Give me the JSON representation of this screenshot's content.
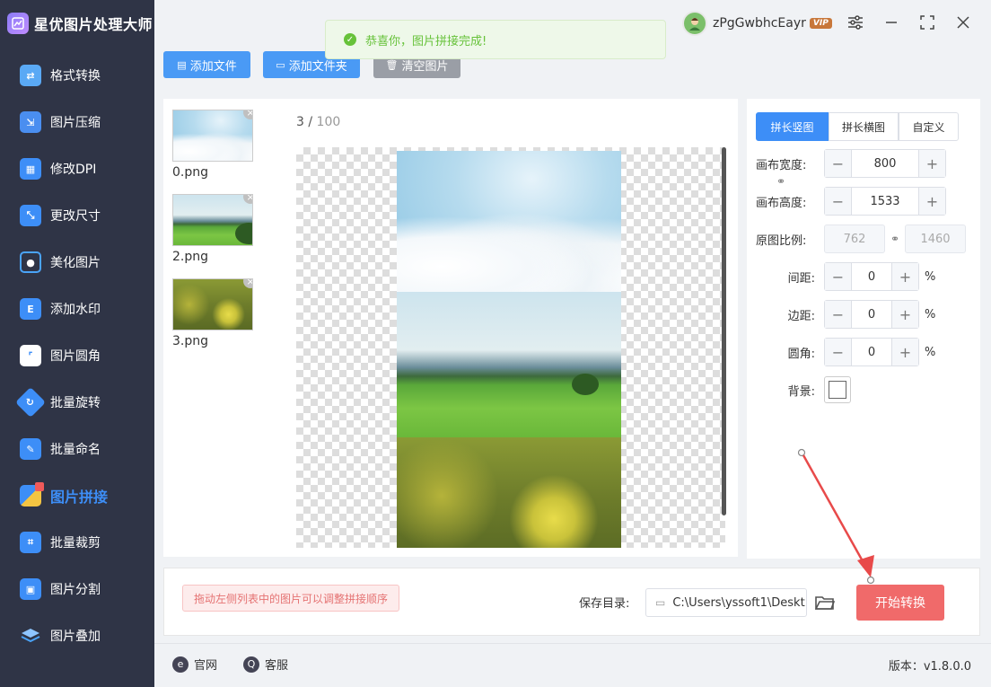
{
  "app": {
    "title": "星优图片处理大师"
  },
  "toast": {
    "text": "恭喜你，图片拼接完成!"
  },
  "user": {
    "name": "zPgGwbhcEayr",
    "badge": "VIP"
  },
  "sidebar": {
    "items": [
      {
        "label": "格式转换",
        "icon": "format-convert-icon"
      },
      {
        "label": "图片压缩",
        "icon": "compress-icon"
      },
      {
        "label": "修改DPI",
        "icon": "dpi-icon"
      },
      {
        "label": "更改尺寸",
        "icon": "resize-icon"
      },
      {
        "label": "美化图片",
        "icon": "beautify-icon"
      },
      {
        "label": "添加水印",
        "icon": "watermark-icon"
      },
      {
        "label": "图片圆角",
        "icon": "round-corner-icon"
      },
      {
        "label": "批量旋转",
        "icon": "rotate-icon"
      },
      {
        "label": "批量命名",
        "icon": "rename-icon"
      },
      {
        "label": "图片拼接",
        "icon": "stitch-icon",
        "active": true
      },
      {
        "label": "批量裁剪",
        "icon": "crop-icon"
      },
      {
        "label": "图片分割",
        "icon": "split-icon"
      },
      {
        "label": "图片叠加",
        "icon": "overlay-icon"
      }
    ]
  },
  "toolbar": {
    "add_file": "添加文件",
    "add_folder": "添加文件夹",
    "clear": "清空图片"
  },
  "files": [
    {
      "name": "0.png"
    },
    {
      "name": "2.png"
    },
    {
      "name": "3.png"
    }
  ],
  "preview": {
    "current": "3",
    "separator": " / ",
    "total": "100"
  },
  "settings": {
    "tabs": [
      "拼长竖图",
      "拼长横图",
      "自定义"
    ],
    "active_tab": "拼长竖图",
    "canvas_width_label": "画布宽度:",
    "canvas_width": "800",
    "canvas_height_label": "画布高度:",
    "canvas_height": "1533",
    "ratio_label": "原图比例:",
    "ratio_w": "762",
    "ratio_h": "1460",
    "spacing_label": "间距:",
    "spacing": "0",
    "margin_label": "边距:",
    "margin": "0",
    "radius_label": "圆角:",
    "radius": "0",
    "percent": "%",
    "background_label": "背景:",
    "minus": "−",
    "plus": "+"
  },
  "bottom": {
    "hint": "拖动左侧列表中的图片可以调整拼接顺序",
    "save_label": "保存目录:",
    "save_path": "C:\\Users\\yssoft1\\Deskt",
    "start_button": "开始转换"
  },
  "footer": {
    "website": "官网",
    "service": "客服",
    "version": "版本：v1.8.0.0"
  },
  "colors": {
    "sidebar_bg": "#2f3446",
    "accent_blue": "#3d8ef7",
    "start_red": "#f06a6a",
    "arrow_red": "#e84a4a",
    "success_green": "#67c23a"
  }
}
